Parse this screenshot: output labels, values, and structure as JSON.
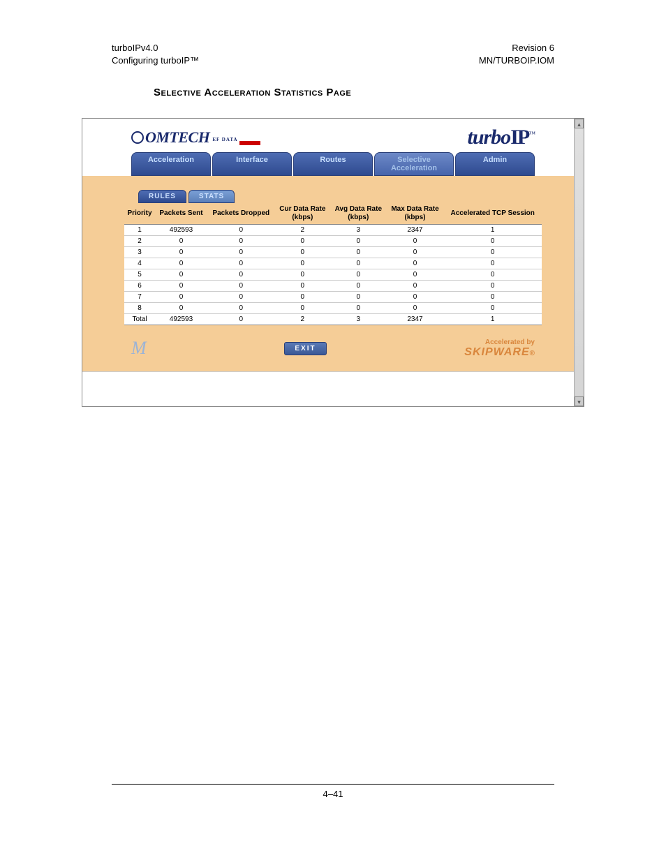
{
  "doc": {
    "header_left_line1": "turboIPv4.0",
    "header_left_line2": "Configuring turboIP™",
    "header_right_line1": "Revision 6",
    "header_right_line2": "MN/TURBOIP.IOM",
    "section_title": "Selective Acceleration Statistics Page",
    "page_number": "4–41"
  },
  "logos": {
    "comtech": "OMTECH",
    "comtech_sub": "EF DATA",
    "turbo": "turbo",
    "ip": "IP",
    "tm": "™"
  },
  "main_tabs": [
    {
      "label": "Acceleration",
      "active": false
    },
    {
      "label": "Interface",
      "active": false
    },
    {
      "label": "Routes",
      "active": false
    },
    {
      "label": "Selective Acceleration",
      "active": true
    },
    {
      "label": "Admin",
      "active": false
    }
  ],
  "sub_tabs": [
    {
      "label": "RULES",
      "active": false
    },
    {
      "label": "STATS",
      "active": true
    }
  ],
  "table": {
    "headers": [
      "Priority",
      "Packets Sent",
      "Packets Dropped",
      "Cur Data Rate (kbps)",
      "Avg Data Rate (kbps)",
      "Max Data Rate (kbps)",
      "Accelerated TCP Session"
    ],
    "rows": [
      [
        "1",
        "492593",
        "0",
        "2",
        "3",
        "2347",
        "1"
      ],
      [
        "2",
        "0",
        "0",
        "0",
        "0",
        "0",
        "0"
      ],
      [
        "3",
        "0",
        "0",
        "0",
        "0",
        "0",
        "0"
      ],
      [
        "4",
        "0",
        "0",
        "0",
        "0",
        "0",
        "0"
      ],
      [
        "5",
        "0",
        "0",
        "0",
        "0",
        "0",
        "0"
      ],
      [
        "6",
        "0",
        "0",
        "0",
        "0",
        "0",
        "0"
      ],
      [
        "7",
        "0",
        "0",
        "0",
        "0",
        "0",
        "0"
      ],
      [
        "8",
        "0",
        "0",
        "0",
        "0",
        "0",
        "0"
      ],
      [
        "Total",
        "492593",
        "0",
        "2",
        "3",
        "2347",
        "1"
      ]
    ]
  },
  "footer": {
    "exit_label": "EXIT",
    "accel_by": "Accelerated by",
    "skipware": "SKIPWARE",
    "reg": "®"
  },
  "glyphs": {
    "up": "▴",
    "down": "▾",
    "squiggle": "M"
  }
}
